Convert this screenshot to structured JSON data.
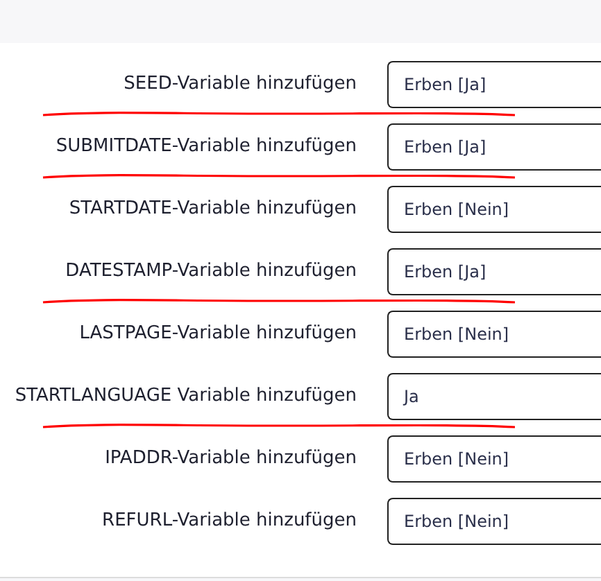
{
  "rows": [
    {
      "label": "SEED-Variable hinzufügen",
      "value": "Erben [Ja]",
      "annotated": true
    },
    {
      "label": "SUBMITDATE-Variable hinzufügen",
      "value": "Erben [Ja]",
      "annotated": true
    },
    {
      "label": "STARTDATE-Variable hinzufügen",
      "value": "Erben [Nein]",
      "annotated": false
    },
    {
      "label": "DATESTAMP-Variable hinzufügen",
      "value": "Erben [Ja]",
      "annotated": true
    },
    {
      "label": "LASTPAGE-Variable hinzufügen",
      "value": "Erben [Nein]",
      "annotated": false
    },
    {
      "label": "STARTLANGUAGE Variable hinzufügen",
      "value": "Ja",
      "annotated": true
    },
    {
      "label": "IPADDR-Variable hinzufügen",
      "value": "Erben [Nein]",
      "annotated": false
    },
    {
      "label": "REFURL-Variable hinzufügen",
      "value": "Erben [Nein]",
      "annotated": false
    }
  ]
}
